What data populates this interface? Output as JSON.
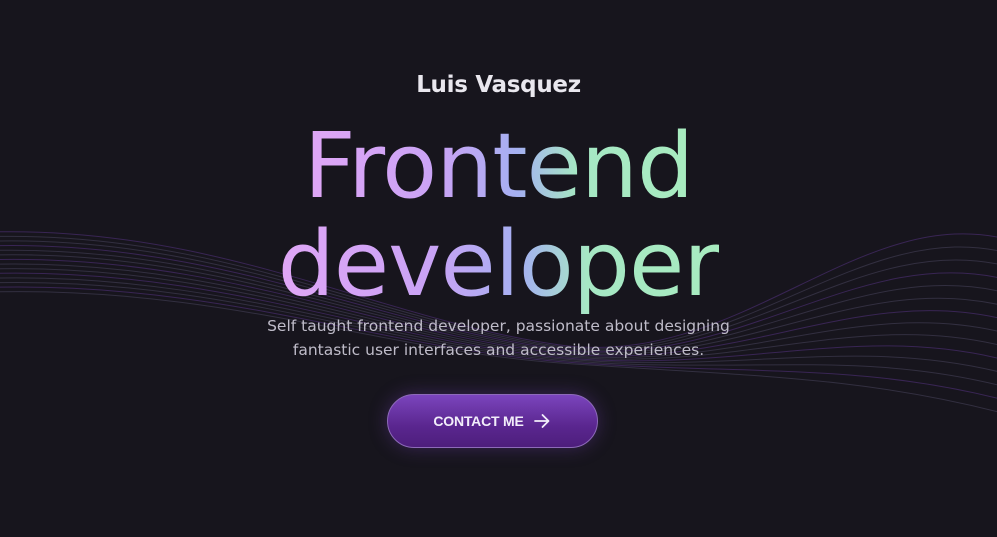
{
  "hero": {
    "name": "Luis Vasquez",
    "headline_line1": "Frontend",
    "headline_line2": "developer",
    "tagline_line1": "Self taught frontend developer, passionate about designing",
    "tagline_line2": "fantastic user interfaces and accessible experiences.",
    "cta_label": "CONTACT ME",
    "cta_icon": "arrow-right-icon"
  },
  "colors": {
    "background": "#17151d",
    "gradient_start": "#e0a6f6",
    "gradient_end": "#a8ecc0",
    "button": "#6a33a8"
  }
}
